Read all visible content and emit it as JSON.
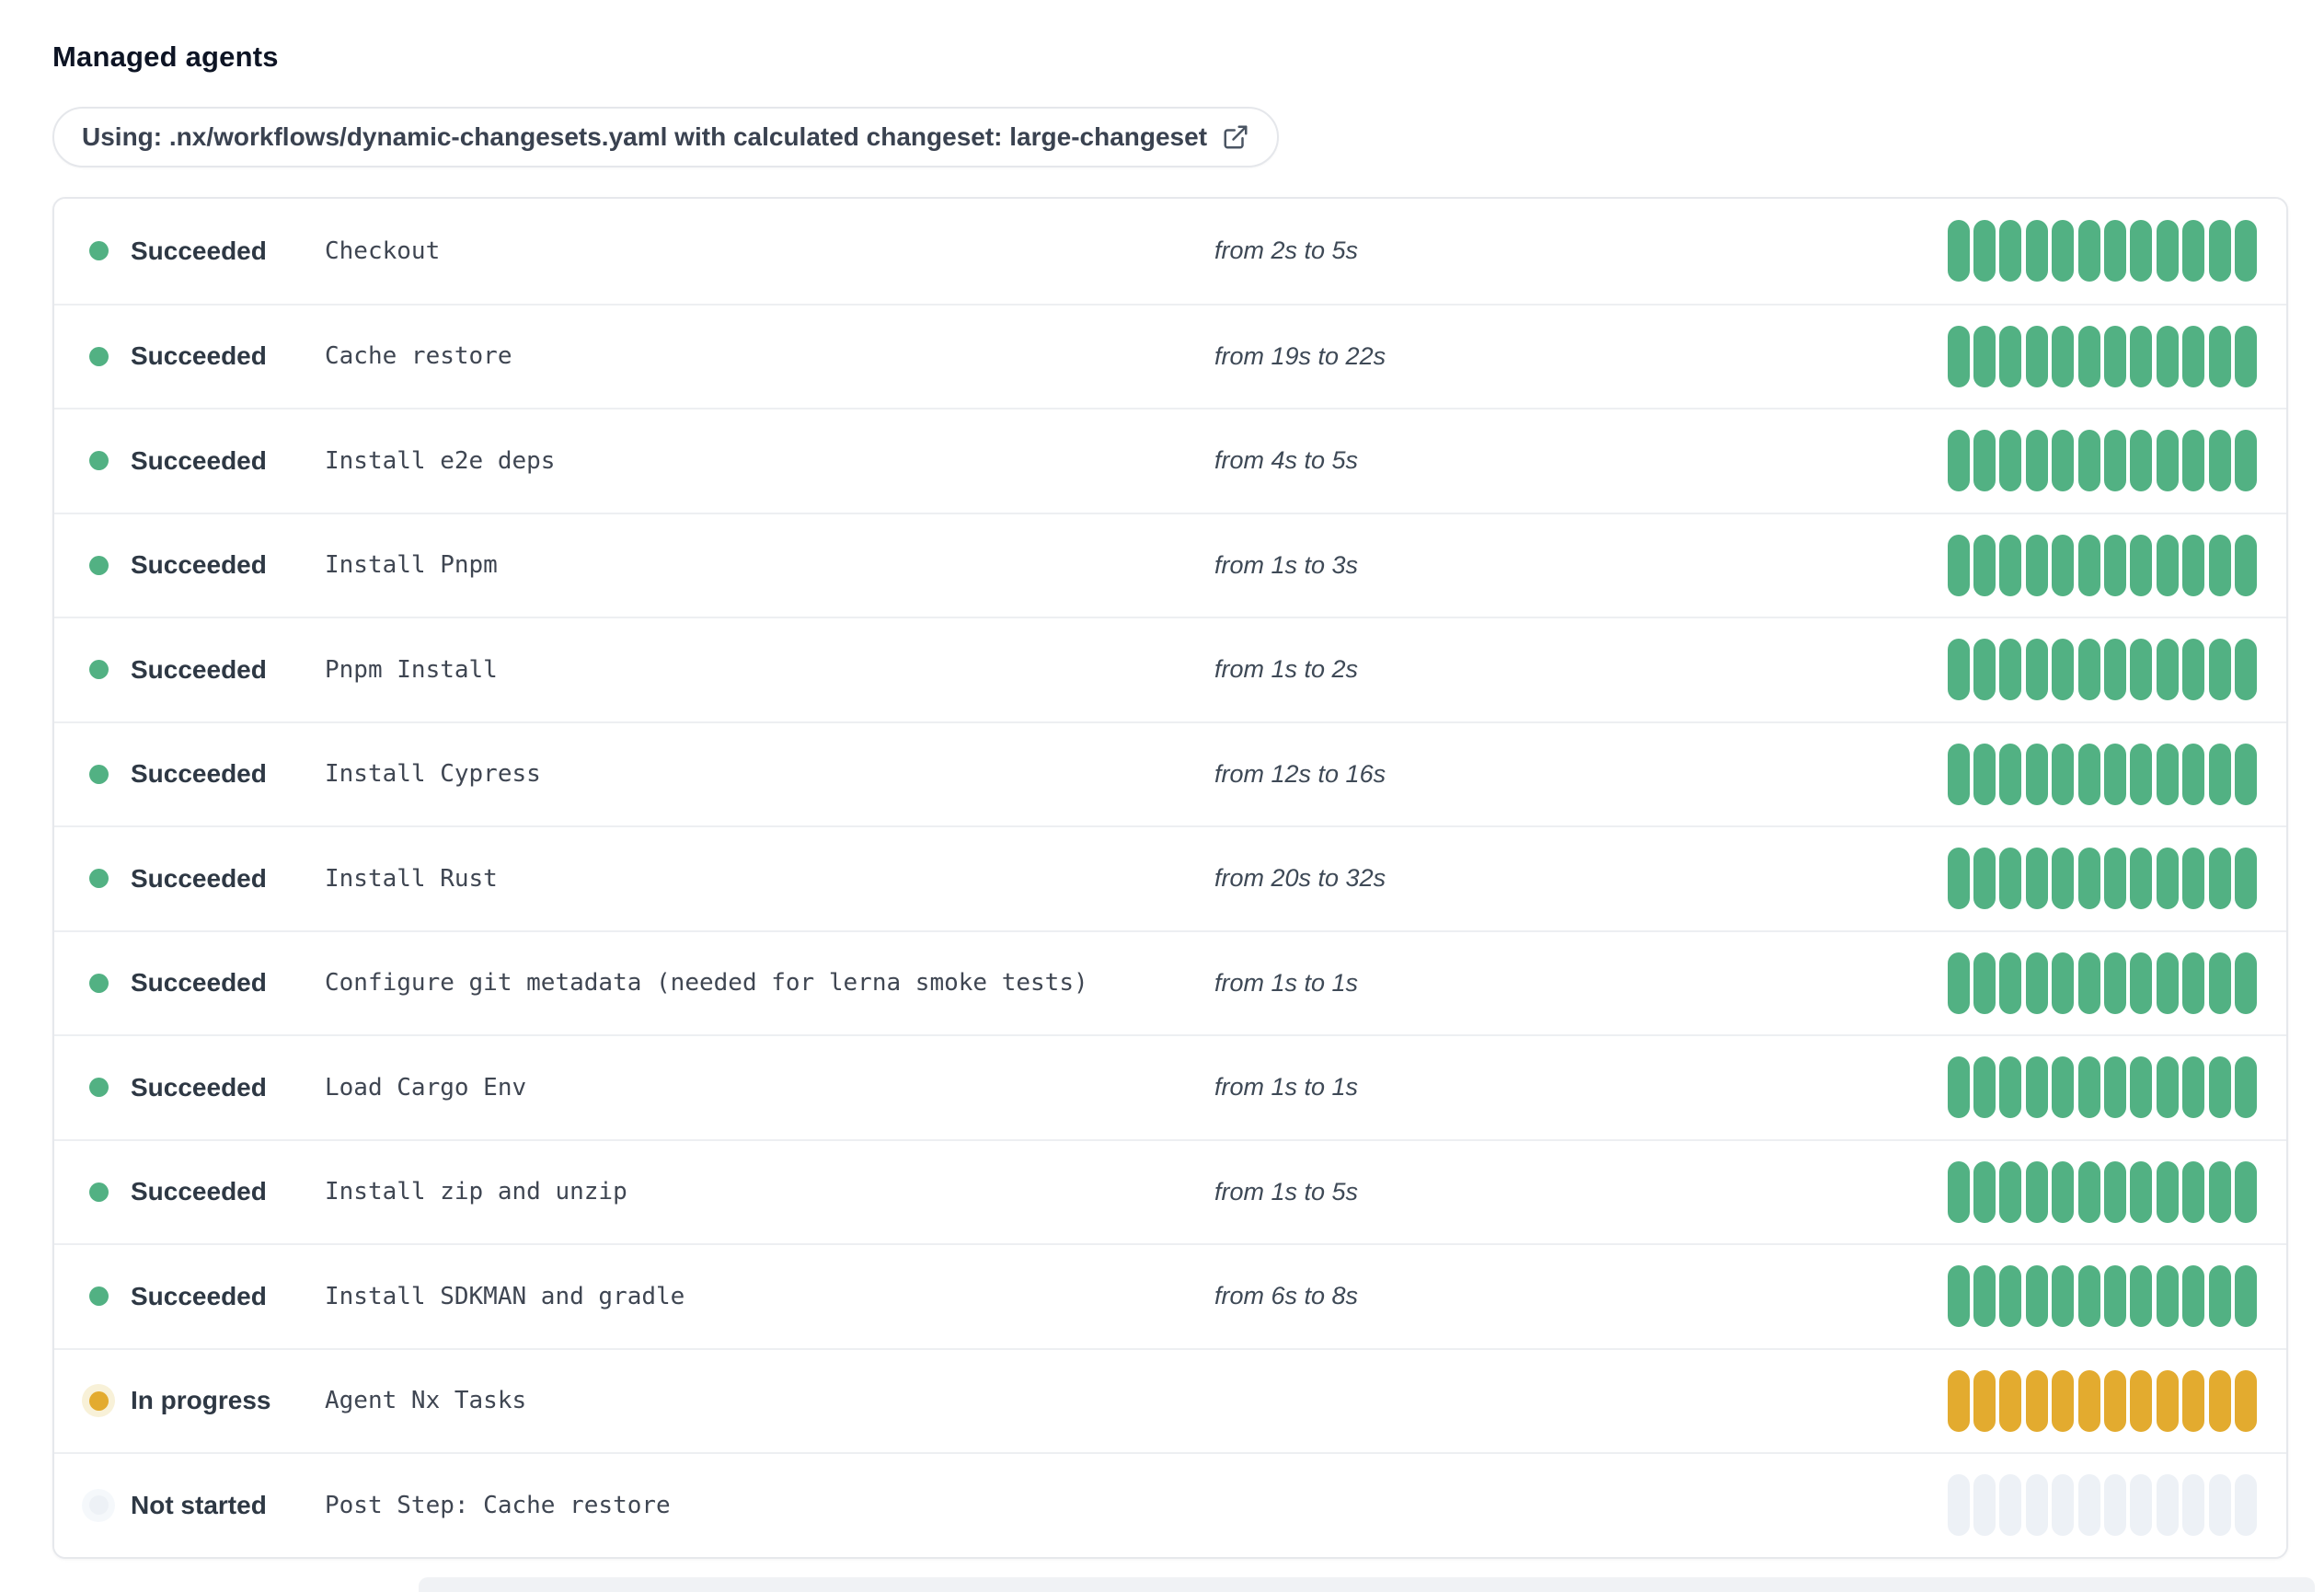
{
  "page": {
    "title": "Managed agents"
  },
  "workflow_banner": {
    "prefix": "Using: ",
    "workflow_file": ".nx/workflows/dynamic-changesets.yaml",
    "middle": " with calculated changeset: ",
    "changeset": "large-changeset",
    "icon": "external-link-icon"
  },
  "agents": {
    "segments_per_bar": 12,
    "rows": [
      {
        "status": "Succeeded",
        "status_key": "succeeded",
        "step": "Checkout",
        "duration": "from 2s to 5s"
      },
      {
        "status": "Succeeded",
        "status_key": "succeeded",
        "step": "Cache restore",
        "duration": "from 19s to 22s"
      },
      {
        "status": "Succeeded",
        "status_key": "succeeded",
        "step": "Install e2e deps",
        "duration": "from 4s to 5s"
      },
      {
        "status": "Succeeded",
        "status_key": "succeeded",
        "step": "Install Pnpm",
        "duration": "from 1s to 3s"
      },
      {
        "status": "Succeeded",
        "status_key": "succeeded",
        "step": "Pnpm Install",
        "duration": "from 1s to 2s"
      },
      {
        "status": "Succeeded",
        "status_key": "succeeded",
        "step": "Install Cypress",
        "duration": "from 12s to 16s"
      },
      {
        "status": "Succeeded",
        "status_key": "succeeded",
        "step": "Install Rust",
        "duration": "from 20s to 32s"
      },
      {
        "status": "Succeeded",
        "status_key": "succeeded",
        "step": "Configure git metadata (needed for lerna smoke tests)",
        "duration": "from 1s to 1s"
      },
      {
        "status": "Succeeded",
        "status_key": "succeeded",
        "step": "Load Cargo Env",
        "duration": "from 1s to 1s"
      },
      {
        "status": "Succeeded",
        "status_key": "succeeded",
        "step": "Install zip and unzip",
        "duration": "from 1s to 5s"
      },
      {
        "status": "Succeeded",
        "status_key": "succeeded",
        "step": "Install SDKMAN and gradle",
        "duration": "from 6s to 8s"
      },
      {
        "status": "In progress",
        "status_key": "in-progress",
        "step": "Agent Nx Tasks",
        "duration": ""
      },
      {
        "status": "Not started",
        "status_key": "not-started",
        "step": "Post Step: Cache restore",
        "duration": ""
      }
    ]
  },
  "colors": {
    "succeeded": "#52b183",
    "in_progress": "#e3ab2f",
    "in_progress_halo": "#f8f1d8",
    "not_started": "#edf1f6",
    "not_started_halo": "#f5f8fb",
    "row_border": "#edeff2",
    "card_border": "#e6e8ec",
    "status_text": "#2e3844",
    "step_text": "#3f4652",
    "duration_text": "#3e4956",
    "title_text": "#0d1424",
    "banner_text": "#3a4250",
    "banner_border": "#e5e7eb"
  }
}
